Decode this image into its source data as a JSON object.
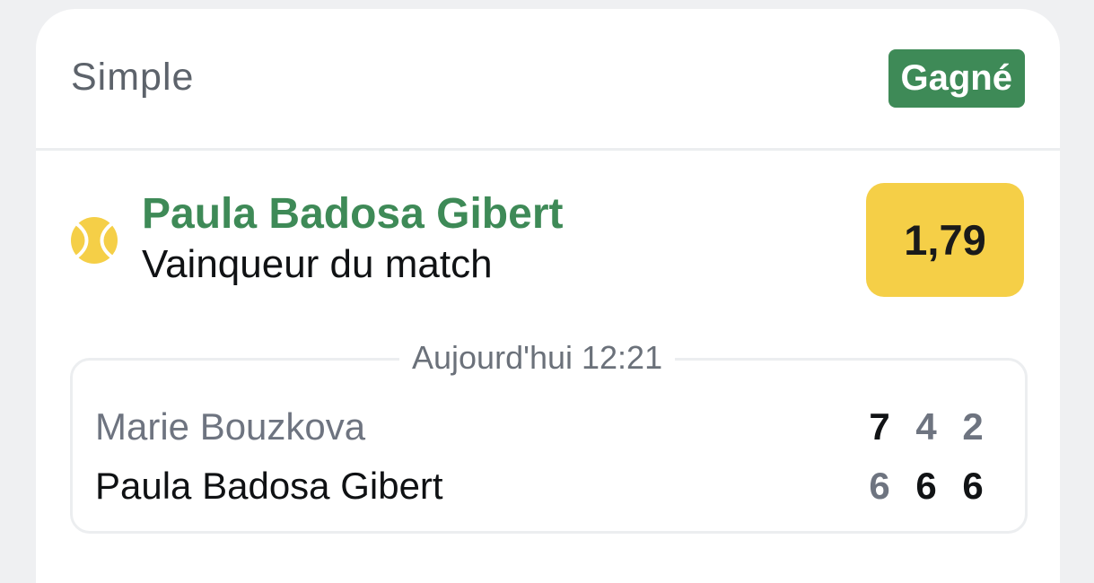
{
  "bet": {
    "type": "Simple",
    "status": "Gagné",
    "status_color": "#3e8a57"
  },
  "selection": {
    "icon": "tennis-ball-icon",
    "name": "Paula Badosa Gibert",
    "market": "Vainqueur du match",
    "odds": "1,79",
    "odds_color": "#f5cf47"
  },
  "match": {
    "time": "Aujourd'hui 12:21",
    "players": [
      {
        "name": "Marie Bouzkova",
        "scores": [
          "7",
          "4",
          "2"
        ]
      },
      {
        "name": "Paula Badosa Gibert",
        "scores": [
          "6",
          "6",
          "6"
        ]
      }
    ]
  }
}
